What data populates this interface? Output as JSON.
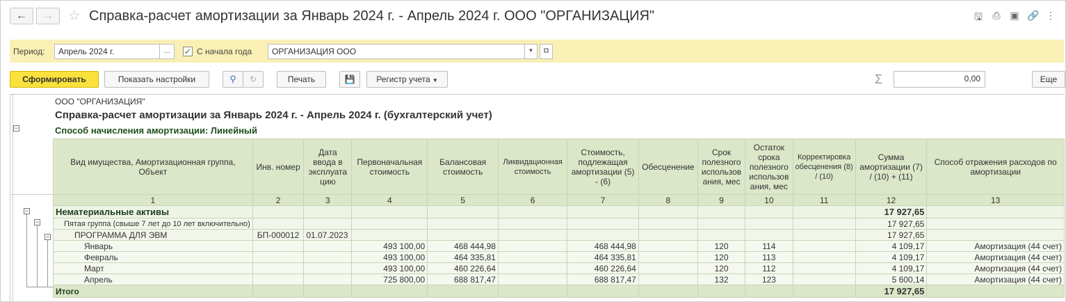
{
  "window": {
    "title": "Справка-расчет амортизации за Январь 2024 г. - Апрель 2024 г. ООО \"ОРГАНИЗАЦИЯ\""
  },
  "filters": {
    "period_label": "Период:",
    "period_value": "Апрель 2024 г.",
    "period_select": "...",
    "from_year_start_label": "С начала года",
    "from_year_start_checked": true,
    "organization_value": "ОРГАНИЗАЦИЯ ООО"
  },
  "toolbar": {
    "generate": "Сформировать",
    "show_settings": "Показать настройки",
    "print": "Печать",
    "register": "Регистр учета",
    "sum_value": "0,00",
    "more": "Еще"
  },
  "report": {
    "org": "ООО \"ОРГАНИЗАЦИЯ\"",
    "title": "Справка-расчет амортизации за Январь 2024 г. - Апрель 2024 г. (бухгалтерский учет)",
    "method": "Способ начисления амортизации:  Линейный",
    "columns": [
      "Вид имущества, Амортизационная группа, Объект",
      "Инв. номер",
      "Дата ввода в эксплуата цию",
      "Первоначальная стоимость",
      "Балансовая стоимость",
      "Ликвидационная стоимость",
      "Стоимость, подлежащая амортизации (5) - (6)",
      "Обесценение",
      "Срок полезного использов ания, мес",
      "Остаток срока полезного использов ания, мес",
      "Корректировка обесценения (8) / (10)",
      "Сумма амортизации (7) / (10) + (11)",
      "Способ отражения расходов по амортизации"
    ],
    "column_numbers": [
      "1",
      "2",
      "3",
      "4",
      "5",
      "6",
      "7",
      "8",
      "9",
      "10",
      "11",
      "12",
      "13"
    ],
    "group": {
      "name": "Нематериальные активы",
      "sum": "17 927,65"
    },
    "subgroup": {
      "name": "Пятая группа (свыше 7 лет до 10 лет включительно)",
      "sum": "17 927,65"
    },
    "object": {
      "name": "ПРОГРАММА ДЛЯ ЭВМ",
      "inv": "БП-000012",
      "date": "01.07.2023",
      "sum": "17 927,65"
    },
    "rows": [
      {
        "month": "Январь",
        "initial": "493 100,00",
        "balance": "468 444,98",
        "depreciable": "468 444,98",
        "life": "120",
        "remaining": "114",
        "amount": "4 109,17",
        "method": "Амортизация (44 счет)"
      },
      {
        "month": "Февраль",
        "initial": "493 100,00",
        "balance": "464 335,81",
        "depreciable": "464 335,81",
        "life": "120",
        "remaining": "113",
        "amount": "4 109,17",
        "method": "Амортизация (44 счет)"
      },
      {
        "month": "Март",
        "initial": "493 100,00",
        "balance": "460 226,64",
        "depreciable": "460 226,64",
        "life": "120",
        "remaining": "112",
        "amount": "4 109,17",
        "method": "Амортизация (44 счет)"
      },
      {
        "month": "Апрель",
        "initial": "725 800,00",
        "balance": "688 817,47",
        "depreciable": "688 817,47",
        "life": "132",
        "remaining": "123",
        "amount": "5 600,14",
        "method": "Амортизация (44 счет)"
      }
    ],
    "total": {
      "label": "Итого",
      "sum": "17 927,65"
    }
  }
}
